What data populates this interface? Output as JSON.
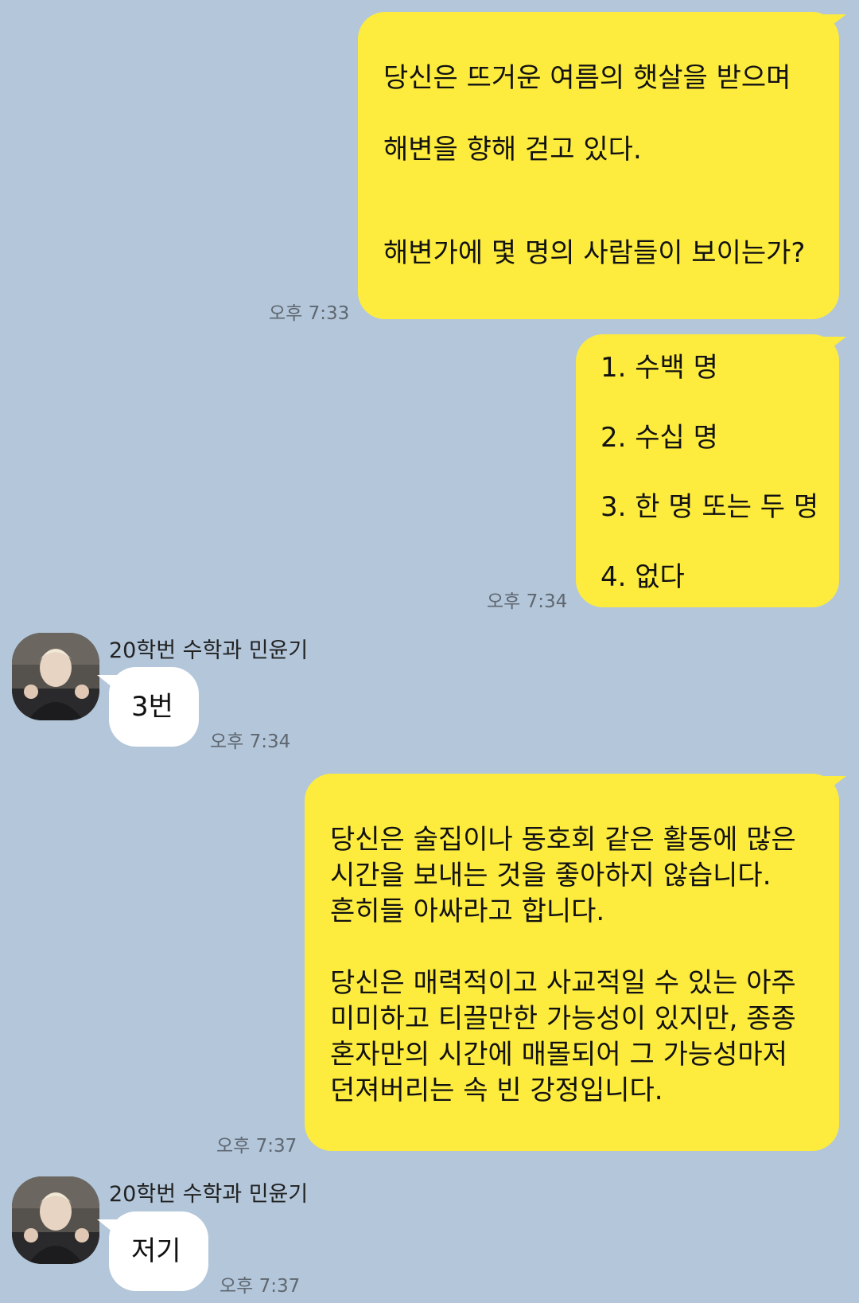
{
  "messages": {
    "m1": {
      "lines": [
        "당신은 뜨거운 여름의 햇살을 받으며",
        "해변을 향해 걷고 있다.",
        "해변가에 몇 명의 사람들이 보이는가?"
      ],
      "time": "오후 7:33"
    },
    "m2": {
      "lines": [
        "1. 수백 명",
        "2. 수십 명",
        "3. 한 명 또는 두 명",
        "4. 없다"
      ],
      "time": "오후 7:34"
    },
    "m3": {
      "sender": "20학번 수학과 민윤기",
      "text": "3번",
      "time": "오후 7:34"
    },
    "m4": {
      "lines": [
        "당신은 술집이나 동호회 같은 활동에 많은",
        "시간을 보내는 것을 좋아하지 않습니다.",
        "흔히들 아싸라고 합니다.",
        "당신은 매력적이고 사교적일 수 있는 아주",
        "미미하고 티끌만한 가능성이 있지만, 종종",
        "혼자만의 시간에 매몰되어 그 가능성마저",
        "던져버리는 속 빈 강정입니다."
      ],
      "time": "오후 7:37"
    },
    "m5": {
      "sender": "20학번 수학과 민윤기",
      "text": "저기",
      "time": "오후 7:37"
    }
  },
  "colors": {
    "background": "#b3c6da",
    "my_bubble": "#fdec3d",
    "their_bubble": "#ffffff"
  },
  "icons": {
    "avatar": "profile-photo"
  }
}
